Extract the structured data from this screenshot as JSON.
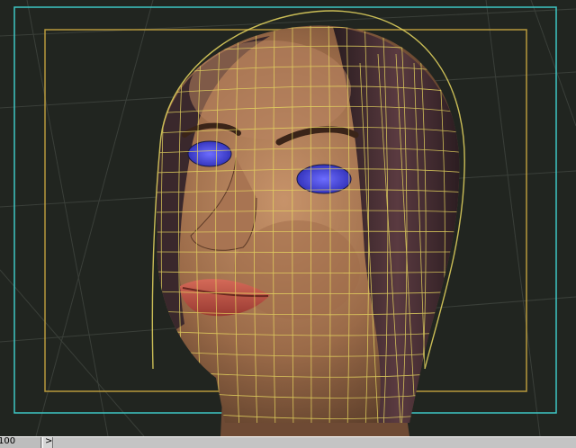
{
  "viewport": {
    "background_color": "#212520",
    "grid_color": "#3a3f39",
    "safe_frame_color": "#3ec6c4",
    "action_safe_color": "#b89a3c",
    "wireframe_color": "#e8d860",
    "skin_color": "#9a6a48",
    "hair_color": "#3a2a2e",
    "lips_color": "#c2564a",
    "eye_color": "#3a3ae0",
    "subject": "head-mesh"
  },
  "statusbar": {
    "frame_value": "100",
    "next_glyph": ">",
    "next_icon": "chevron-right-icon"
  }
}
